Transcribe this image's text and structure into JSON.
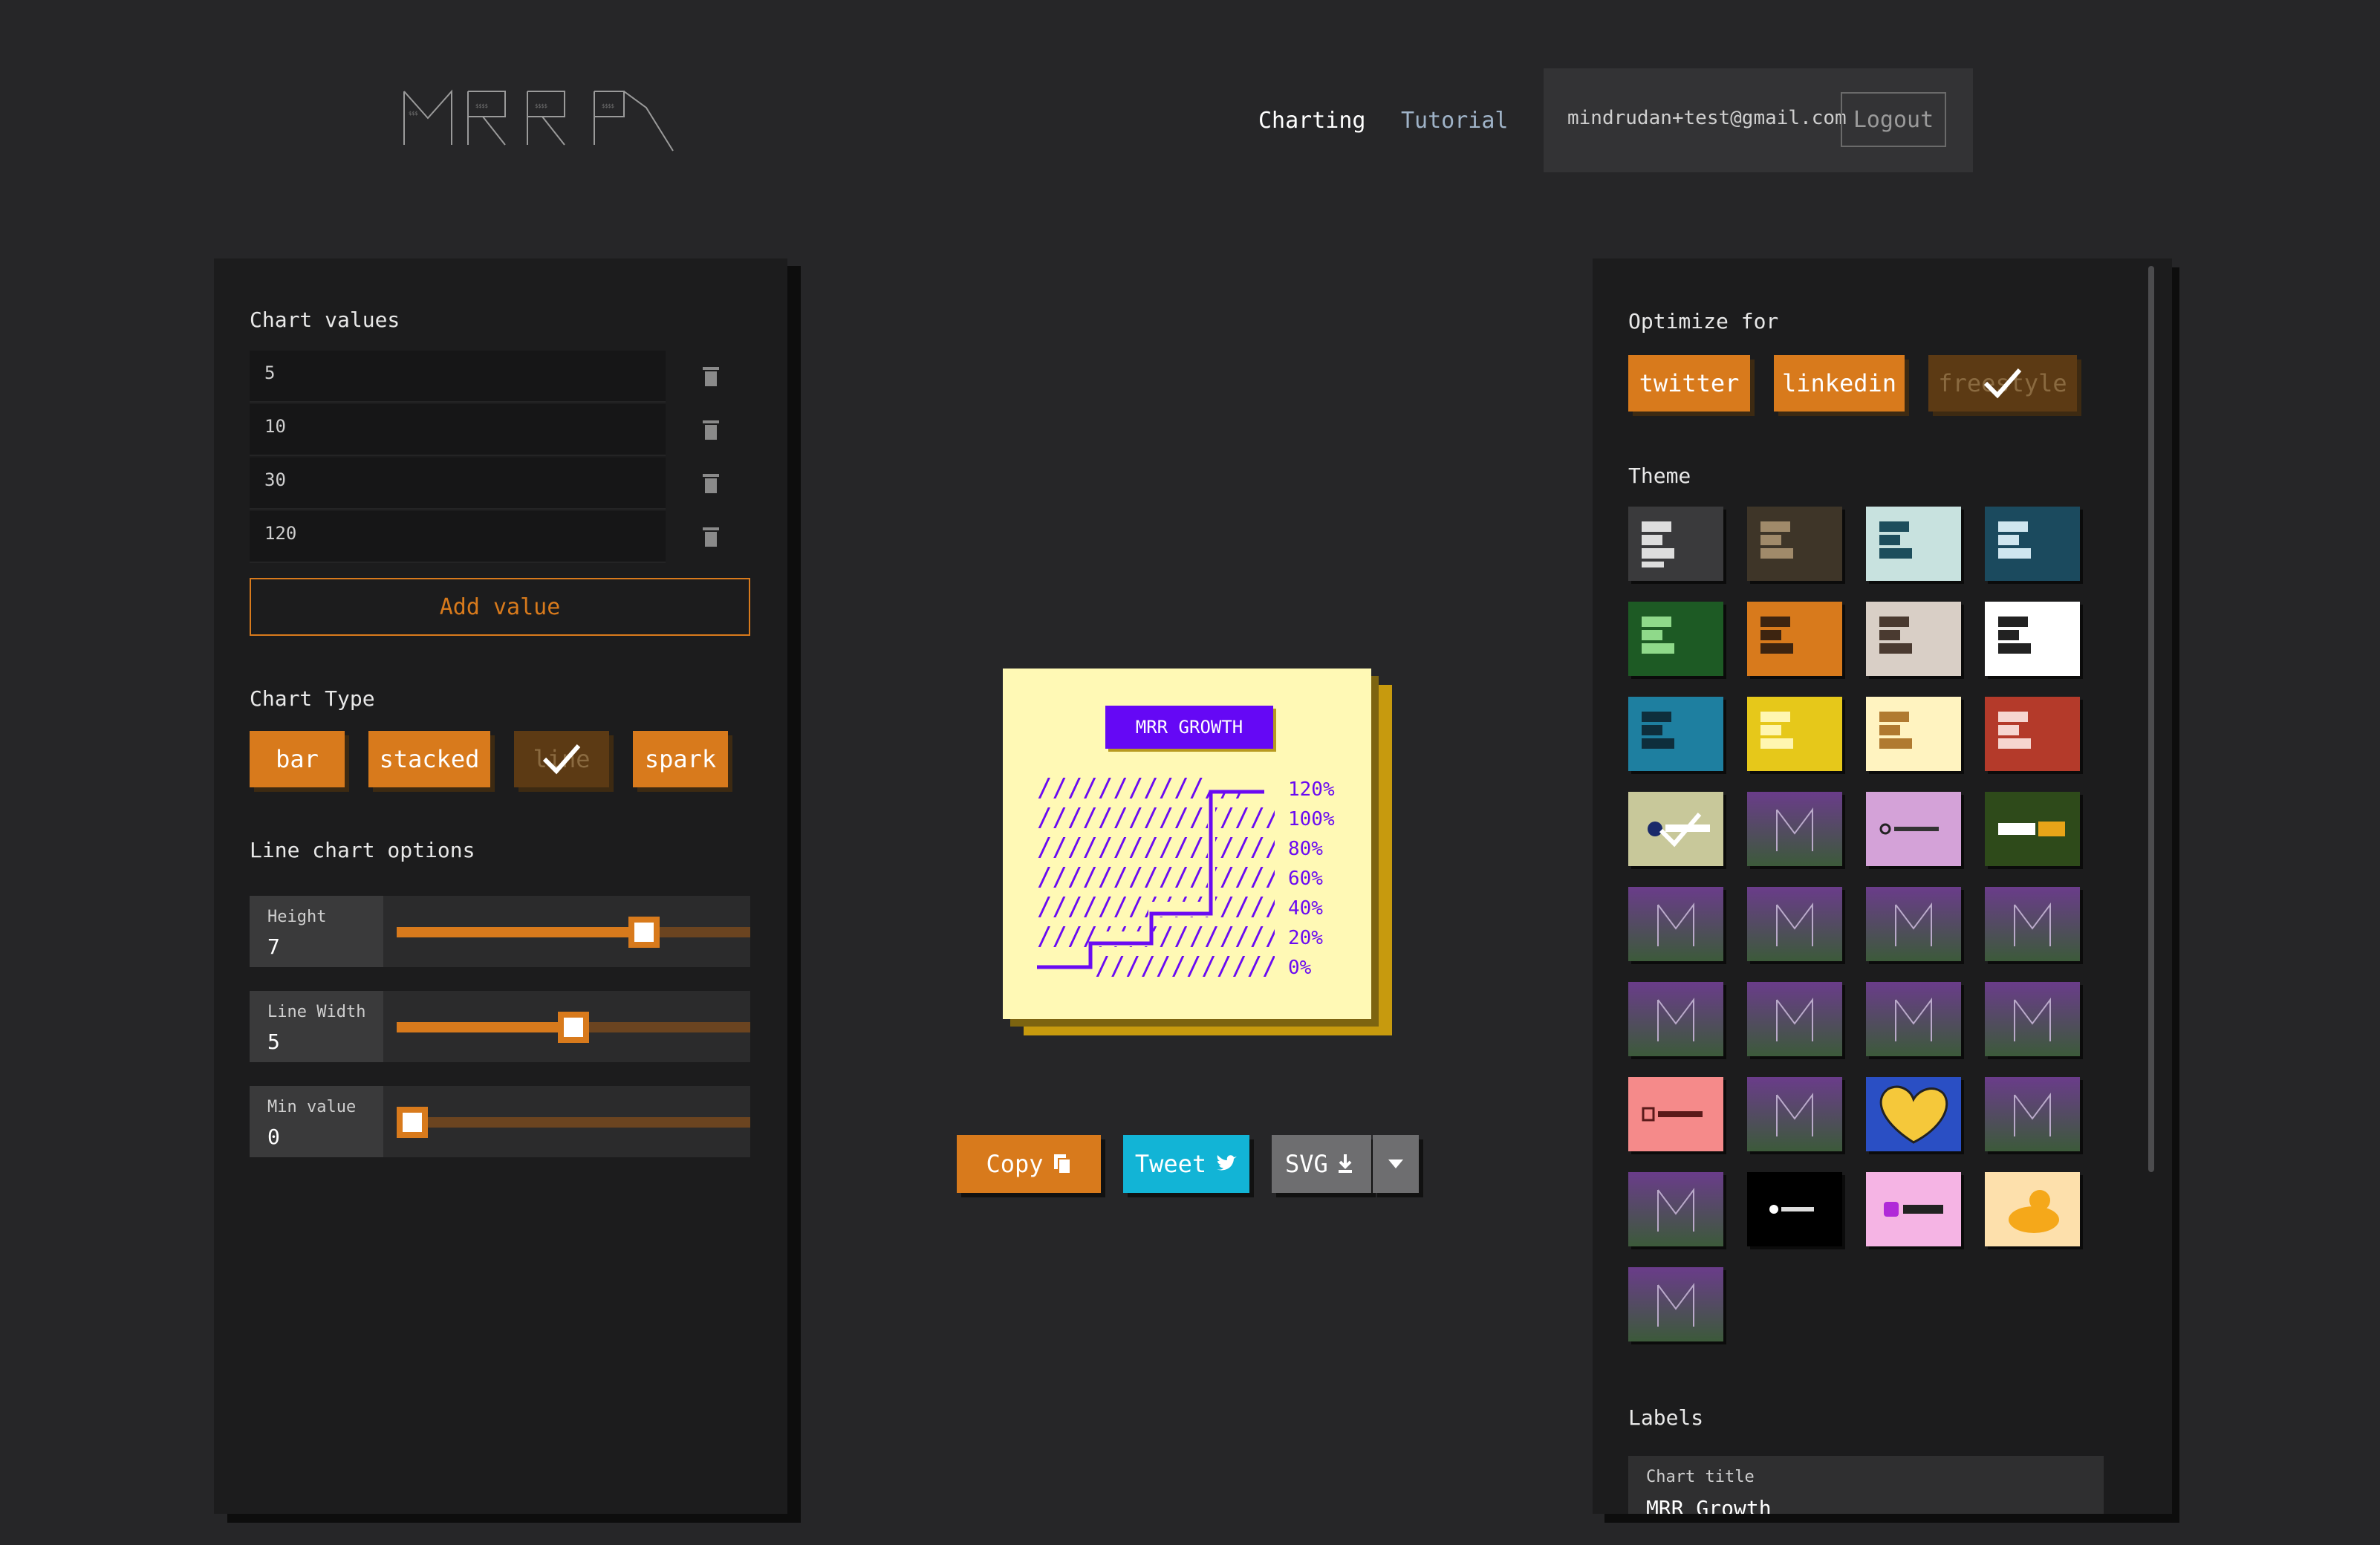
{
  "header": {
    "logo_text": "MRR",
    "nav_active": "Charting",
    "nav_inactive": "Tutorial",
    "email": "mindrudan+test@gmail.com",
    "logout_label": "Logout"
  },
  "left_panel": {
    "chart_values_title": "Chart values",
    "values": [
      "5",
      "10",
      "30",
      "120"
    ],
    "add_value_label": "Add value",
    "chart_type_title": "Chart Type",
    "chart_types": [
      "bar",
      "stacked",
      "line",
      "spark"
    ],
    "selected_chart_type": "line",
    "line_options_title": "Line chart options",
    "sliders": [
      {
        "name": "Height",
        "value": "7",
        "fraction": 0.7
      },
      {
        "name": "Line Width",
        "value": "5",
        "fraction": 0.5
      },
      {
        "name": "Min value",
        "value": "0",
        "fraction": 0.0
      }
    ]
  },
  "preview": {
    "chart_title": "MRR GROWTH",
    "percent_labels": [
      "120%",
      "100%",
      "80%",
      "60%",
      "40%",
      "20%",
      "0%"
    ]
  },
  "actions": {
    "copy_label": "Copy",
    "tweet_label": "Tweet",
    "svg_label": "SVG"
  },
  "right_panel": {
    "optimize_title": "Optimize for",
    "optimize_options": [
      "twitter",
      "linkedin",
      "freestyle"
    ],
    "selected_optimize": "freestyle",
    "theme_title": "Theme",
    "labels_title": "Labels",
    "chart_title_field_label": "Chart title",
    "chart_title_field_value": "MRR Growth"
  },
  "colors": {
    "accent": "#d87a1c",
    "tweet": "#12b4d6",
    "purple": "#6508f5",
    "card": "#fff9b5"
  }
}
